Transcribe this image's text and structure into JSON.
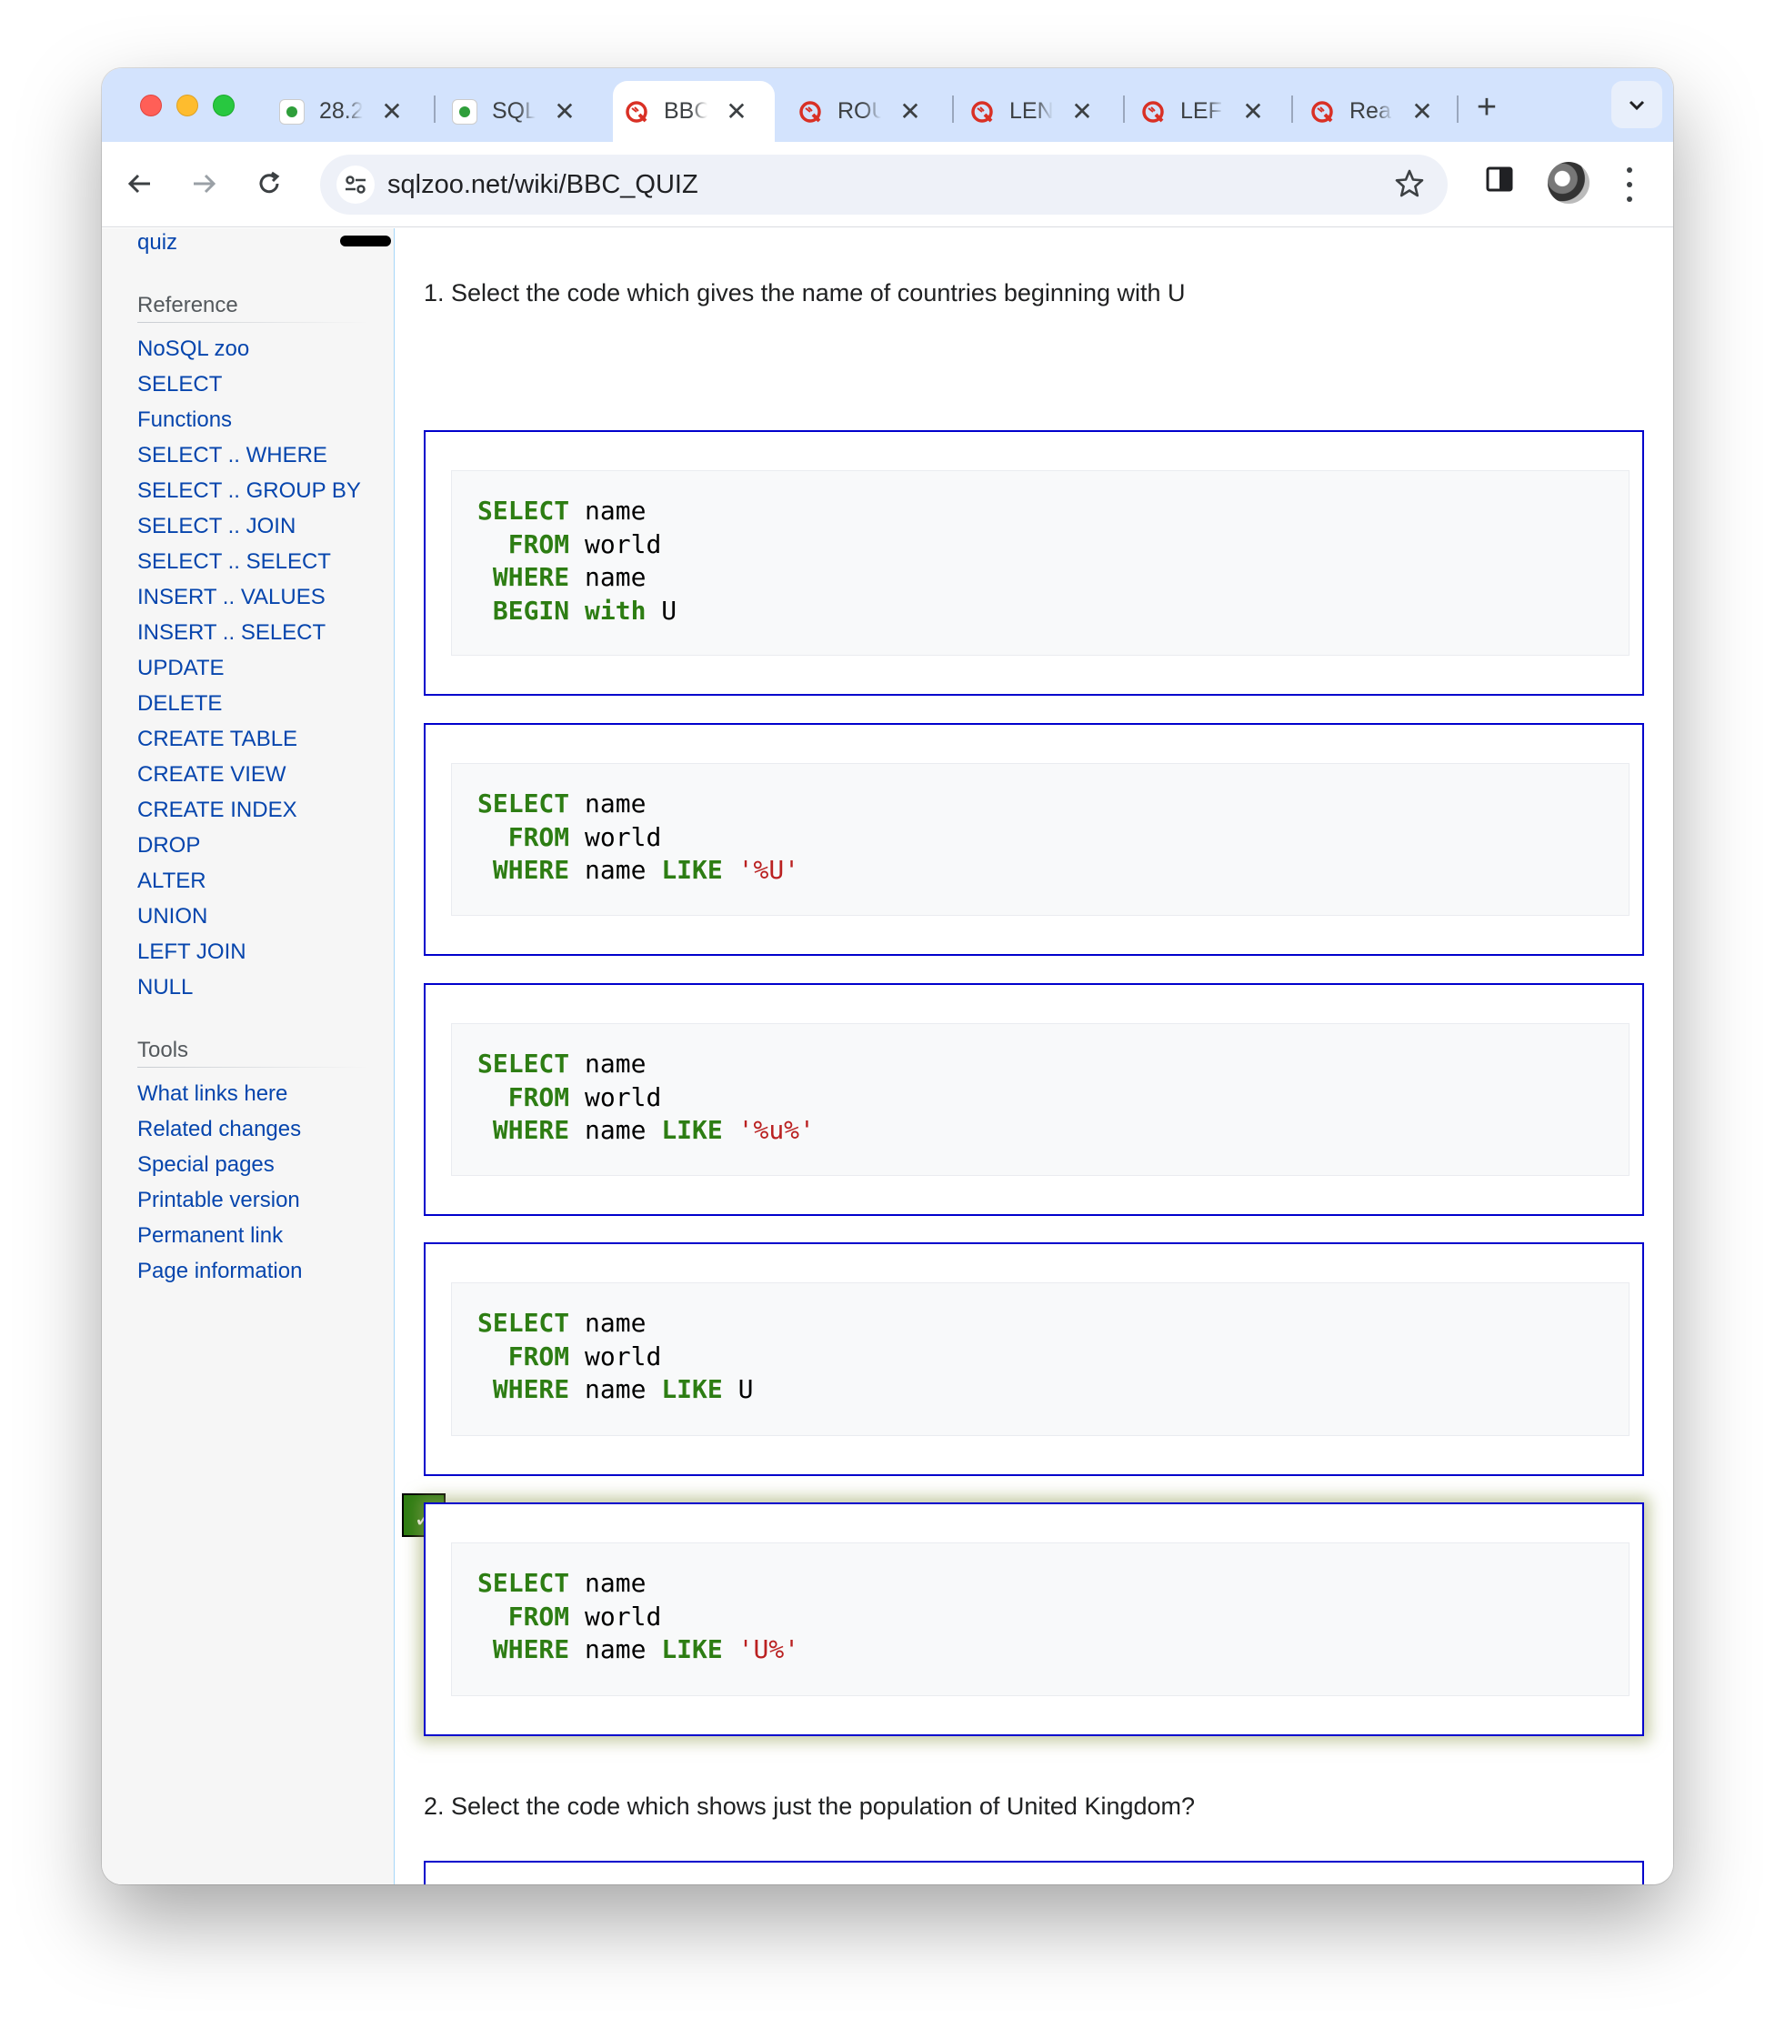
{
  "browser": {
    "tabs": [
      {
        "title": "28.2",
        "favicon": "green-person-icon",
        "active": false
      },
      {
        "title": "SQL",
        "favicon": "green-person-icon",
        "active": false
      },
      {
        "title": "BBC",
        "favicon": "sqlzoo-icon",
        "active": true
      },
      {
        "title": "ROU",
        "favicon": "sqlzoo-icon",
        "active": false
      },
      {
        "title": "LEN",
        "favicon": "sqlzoo-icon",
        "active": false
      },
      {
        "title": "LEF",
        "favicon": "sqlzoo-icon",
        "active": false
      },
      {
        "title": "Rea",
        "favicon": "sqlzoo-icon",
        "active": false
      }
    ],
    "close_glyph": "✕",
    "new_tab_glyph": "+",
    "url": "sqlzoo.net/wiki/BBC_QUIZ"
  },
  "sidebar": {
    "top_link": "quiz",
    "reference_heading": "Reference",
    "reference_links": [
      "NoSQL zoo",
      "SELECT",
      "Functions",
      "SELECT .. WHERE",
      "SELECT .. GROUP BY",
      "SELECT .. JOIN",
      "SELECT .. SELECT",
      "INSERT .. VALUES",
      "INSERT .. SELECT",
      "UPDATE",
      "DELETE",
      "CREATE TABLE",
      "CREATE VIEW",
      "CREATE INDEX",
      "DROP",
      "ALTER",
      "UNION",
      "LEFT JOIN",
      "NULL"
    ],
    "tools_heading": "Tools",
    "tools_links": [
      "What links here",
      "Related changes",
      "Special pages",
      "Printable version",
      "Permanent link",
      "Page information"
    ]
  },
  "quiz": {
    "question1": "1. Select the code which gives the name of countries beginning with U",
    "answers": [
      {
        "lines": [
          [
            "SELECT",
            " name"
          ],
          [
            "  FROM",
            " world"
          ],
          [
            " WHERE",
            " name"
          ],
          [
            " BEGIN",
            " ",
            "with",
            " U"
          ]
        ],
        "correct": false
      },
      {
        "lines": [
          [
            "SELECT",
            " name"
          ],
          [
            "  FROM",
            " world"
          ],
          [
            " WHERE",
            " name ",
            "LIKE",
            " ",
            "'%U'"
          ]
        ],
        "correct": false
      },
      {
        "lines": [
          [
            "SELECT",
            " name"
          ],
          [
            "  FROM",
            " world"
          ],
          [
            " WHERE",
            " name ",
            "LIKE",
            " ",
            "'%u%'"
          ]
        ],
        "correct": false
      },
      {
        "lines": [
          [
            "SELECT",
            " name"
          ],
          [
            "  FROM",
            " world"
          ],
          [
            " WHERE",
            " name ",
            "LIKE",
            " U"
          ]
        ],
        "correct": false
      },
      {
        "lines": [
          [
            "SELECT",
            " name"
          ],
          [
            "  FROM",
            " world"
          ],
          [
            " WHERE",
            " name ",
            "LIKE",
            " ",
            "'U%'"
          ]
        ],
        "correct": true
      }
    ],
    "check_glyph": "✓",
    "question2": "2. Select the code which shows just the population of United Kingdom?"
  },
  "colors": {
    "link": "#0645ad",
    "keyword": "#2d7d13",
    "string": "#ba2121",
    "answer_border": "#0000cc",
    "correct_badge": "#2e7d12"
  }
}
